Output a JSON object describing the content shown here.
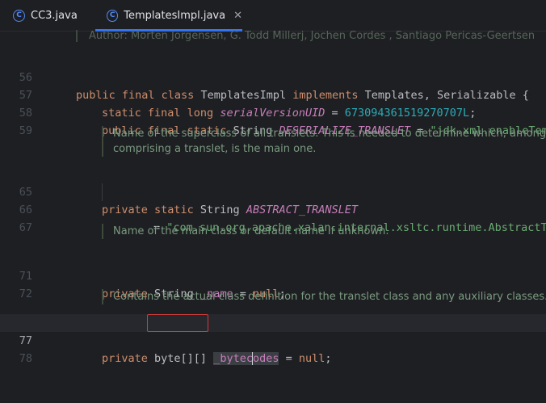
{
  "tabs": [
    {
      "label": "CC3.java",
      "icon": "java-class-icon"
    },
    {
      "label": "TemplatesImpl.java",
      "icon": "java-class-icon",
      "close": "✕"
    }
  ],
  "author_line": "Author: Morten Jorgensen, G. Todd Millerj, Jochen Cordes , Santiago Pericas-Geertsen",
  "lines": {
    "l56": "56",
    "l57": "57",
    "l58": "58",
    "l59": "59",
    "l65": "65",
    "l66": "66",
    "l67": "67",
    "l71": "71",
    "l72": "72",
    "l77": "77",
    "l78": "78"
  },
  "code": {
    "c56_kw": "public final class ",
    "c56_name": "TemplatesImpl ",
    "c56_impl": "implements ",
    "c56_rest": "Templates, Serializable {",
    "c57_kw": "static final long ",
    "c57_name": "serialVersionUID",
    "c57_eq": " = ",
    "c57_num": "673094361519270707L",
    "c57_end": ";",
    "c58_kw": "public final static ",
    "c58_type": "String ",
    "c58_name": "DESERIALIZE_TRANSLET",
    "c58_eq": " = ",
    "c58_str": "\"jdk.xml.enableTemp",
    "c65_kw": "private static ",
    "c65_type": "String ",
    "c65_name": "ABSTRACT_TRANSLET",
    "c66_eq": "= ",
    "c66_str": "\"com.sun.org.apache.xalan.internal.xsltc.runtime.AbstractTr",
    "c71_kw": "private ",
    "c71_type": "String ",
    "c71_name": "_name",
    "c71_eq": " = ",
    "c71_null": "null",
    "c71_end": ";",
    "c77_kw": "private ",
    "c77_type": "byte[][] ",
    "c77_name_a": "_bytec",
    "c77_name_b": "odes",
    "c77_eq": " = ",
    "c77_null": "null",
    "c77_end": ";"
  },
  "docs": {
    "d1_a": "Name of the superclass of all translets. This is needed to determine which, among all",
    "d1_b": "comprising a translet, is the main one.",
    "d2": "Name of the main class or default name if unknown.",
    "d3": "Contains the actual class definition for the translet class and any auxiliary classes."
  }
}
